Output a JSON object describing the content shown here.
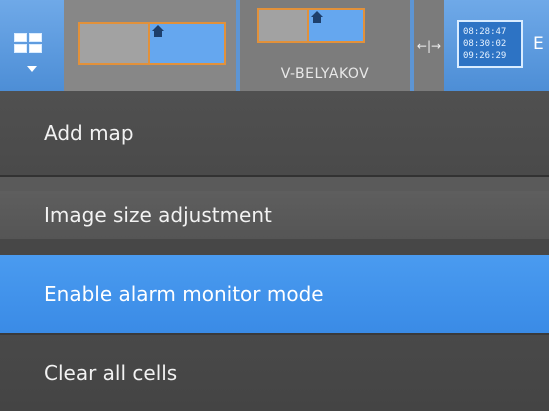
{
  "toolbar": {
    "layout_name": "V-BELYAKOV",
    "splitter_glyph": "←|→",
    "clock_lines": [
      "08:28:47",
      "08:30:02",
      "09:26:29"
    ],
    "clock_label_partial": "E"
  },
  "icons": {
    "layout_grid": "layout-grid-icon",
    "dropdown": "chevron-down-icon",
    "home": "home-icon",
    "splitter": "resize-splitter-icon",
    "clock": "clock-icon"
  },
  "menu": {
    "items": [
      {
        "label": "Add map"
      },
      {
        "label": "Image size adjustment"
      },
      {
        "label": "Enable alarm monitor mode"
      },
      {
        "label": "Clear all cells"
      }
    ]
  },
  "colors": {
    "accent_blue": "#4a9bf0",
    "layout_border_orange": "#e2913a",
    "menu_bg": "#4a4a4a"
  }
}
